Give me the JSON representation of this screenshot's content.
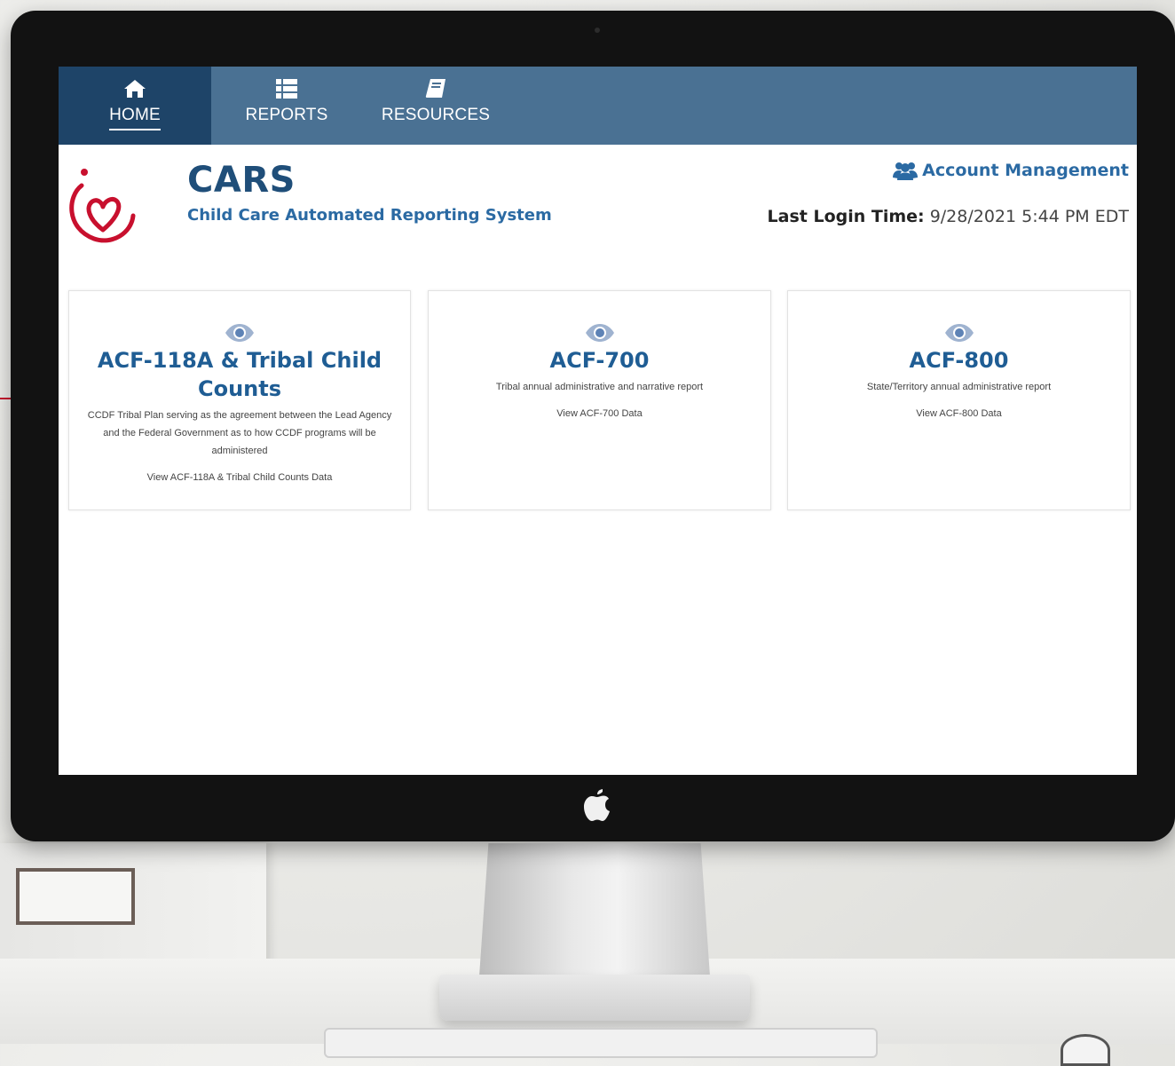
{
  "nav": {
    "items": [
      {
        "label": "HOME",
        "icon": "home-icon",
        "active": true
      },
      {
        "label": "REPORTS",
        "icon": "list-icon",
        "active": false
      },
      {
        "label": "RESOURCES",
        "icon": "book-icon",
        "active": false
      }
    ]
  },
  "header": {
    "title": "CARS",
    "subtitle": "Child Care Automated Reporting System",
    "account_link": "Account Management",
    "account_icon": "users-icon",
    "last_login_label": "Last Login Time:",
    "last_login_value": "9/28/2021 5:44 PM EDT"
  },
  "cards": [
    {
      "icon": "eye-icon",
      "title": "ACF-118A & Tribal Child Counts",
      "description": "CCDF Tribal Plan serving as the agreement between the Lead Agency and the Federal Government as to how CCDF programs will be administered",
      "link": "View ACF-118A & Tribal Child Counts Data"
    },
    {
      "icon": "eye-icon",
      "title": "ACF-700",
      "description": "Tribal annual administrative and narrative report",
      "link": "View ACF-700 Data"
    },
    {
      "icon": "eye-icon",
      "title": "ACF-800",
      "description": "State/Territory annual administrative report",
      "link": "View ACF-800 Data"
    }
  ],
  "colors": {
    "nav_bg": "#4a7193",
    "nav_active_bg": "#1e4468",
    "title_blue": "#1f4e79",
    "link_blue": "#2b6aa3",
    "logo_red": "#c8102e"
  }
}
